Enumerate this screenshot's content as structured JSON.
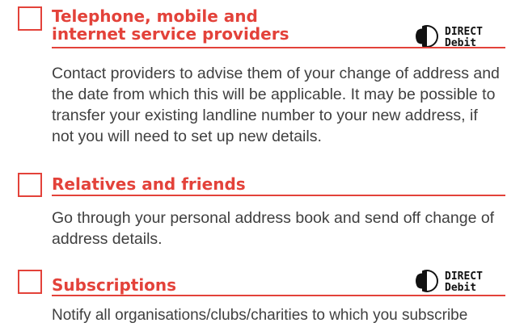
{
  "sections": [
    {
      "title_line1": "Telephone, mobile and",
      "title_line2": "internet service providers",
      "body": "Contact providers to advise them of your change of address and the date from which this will be applicable. It may be possible to transfer your existing landline number to your new address, if not you will need to set up new details.",
      "logo": {
        "line1": "DIRECT",
        "line2": "Debit"
      }
    },
    {
      "title": "Relatives and friends",
      "body": "Go through your personal address book and send off change of address details."
    },
    {
      "title": "Subscriptions",
      "body": "Notify all organisations/clubs/charities to which you subscribe",
      "logo": {
        "line1": "DIRECT",
        "line2": "Debit"
      }
    }
  ],
  "colors": {
    "accent": "#e3423a",
    "text": "#3f3f3f",
    "logo": "#111111"
  },
  "icons": [
    "checkbox-icon",
    "direct-debit-logo-icon"
  ]
}
